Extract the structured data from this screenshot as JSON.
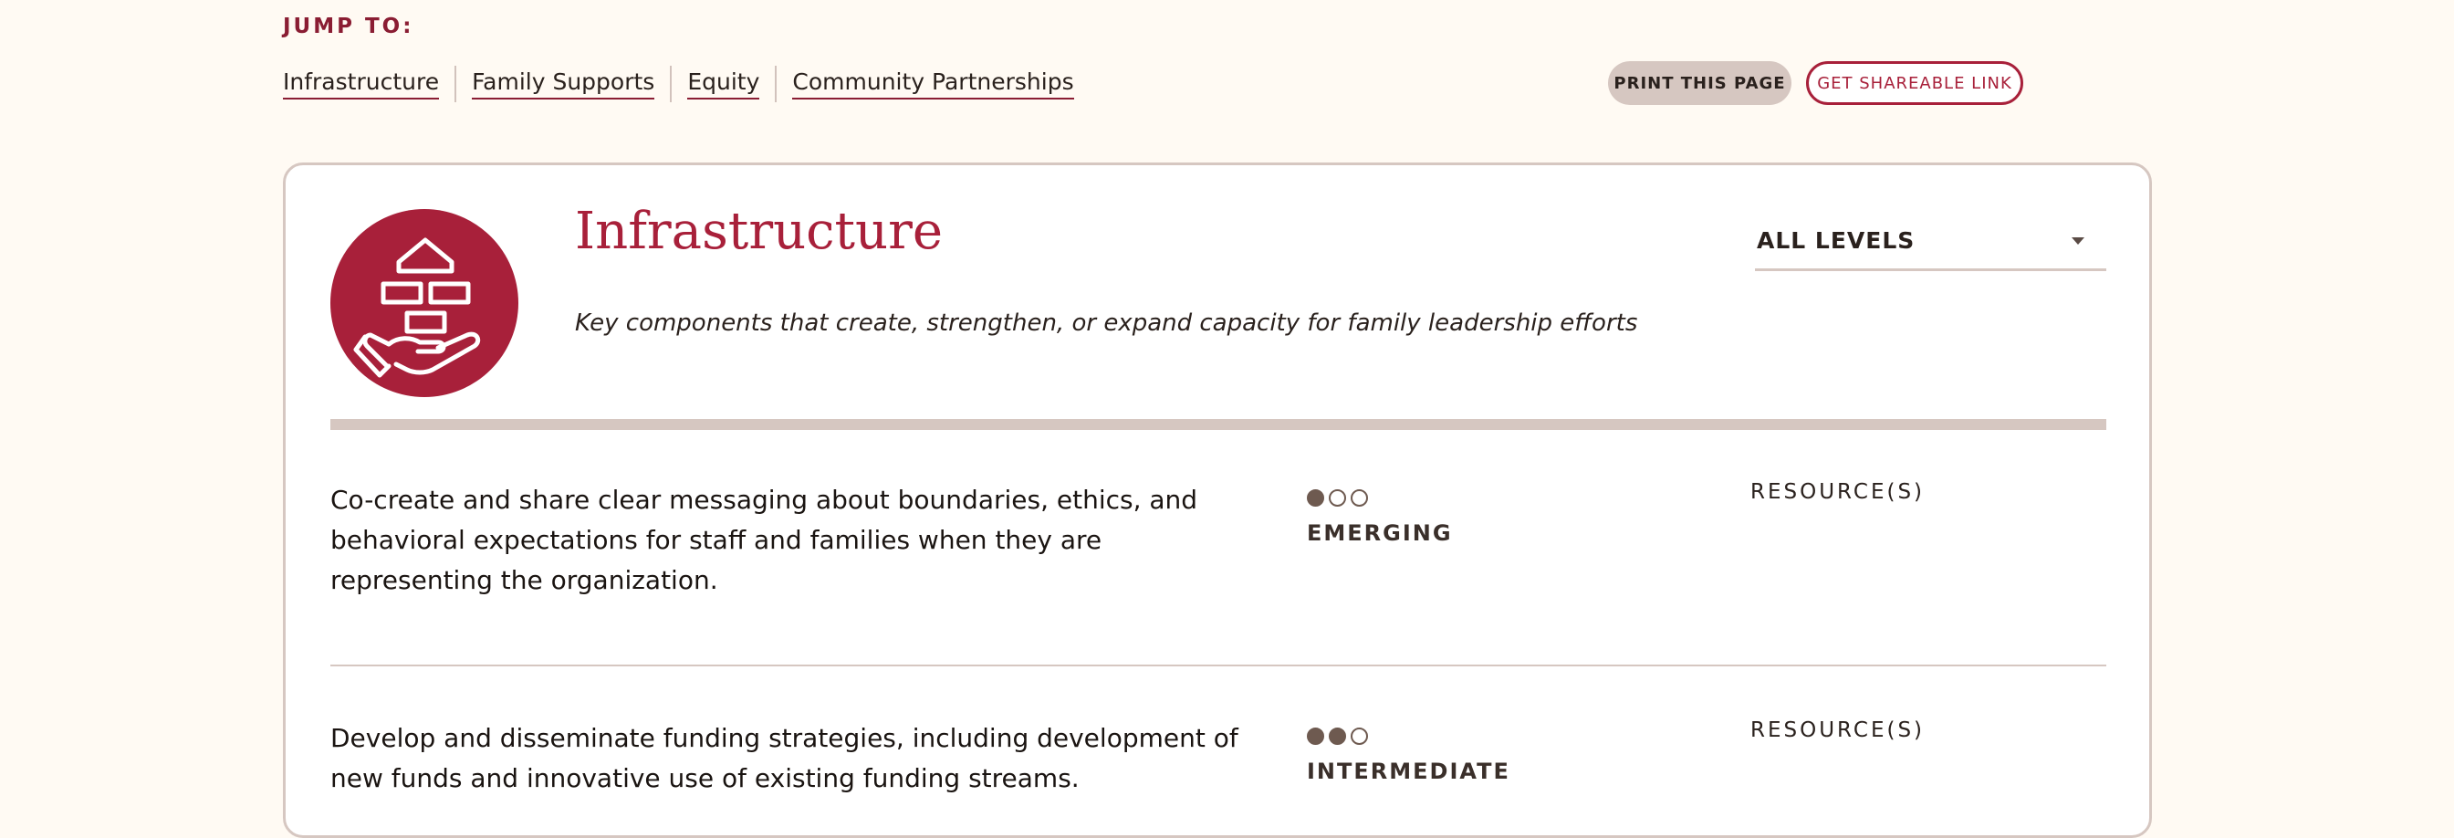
{
  "jump_to": {
    "label": "JUMP TO:",
    "links": [
      "Infrastructure",
      "Family Supports",
      "Equity",
      "Community Partnerships"
    ]
  },
  "actions": {
    "print_label": "PRINT THIS PAGE",
    "share_label": "GET SHAREABLE LINK"
  },
  "section": {
    "title": "Infrastructure",
    "description": "Key components that create, strengthen, or expand capacity for family leadership efforts",
    "icon": "hand-holding-building-icon",
    "filter_value": "ALL LEVELS"
  },
  "colors": {
    "accent": "#a8203a",
    "divider": "#d6c7c1",
    "background": "#fffaf3"
  },
  "items": [
    {
      "text": "Co-create and share clear messaging about boundaries, ethics, and behavioral expectations for staff and families when they are representing the organization.",
      "level": "EMERGING",
      "level_rank": 1,
      "resources_label": "RESOURCE(S)"
    },
    {
      "text": "Develop and disseminate funding strategies, including development of new funds and innovative use of existing funding streams.",
      "level": "INTERMEDIATE",
      "level_rank": 2,
      "resources_label": "RESOURCE(S)"
    }
  ]
}
